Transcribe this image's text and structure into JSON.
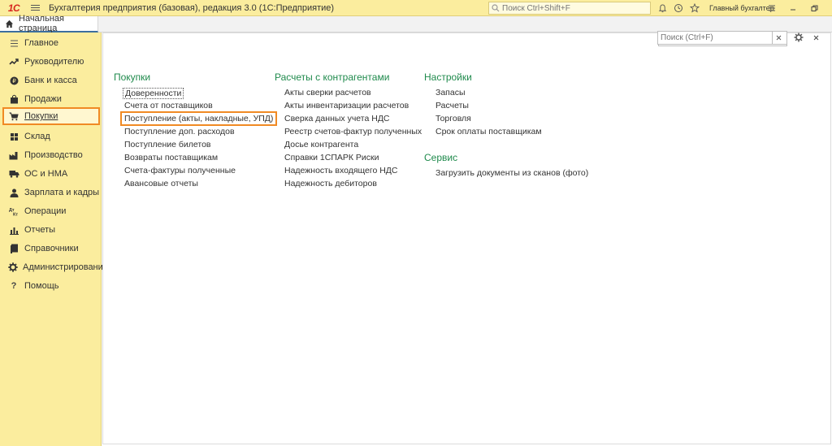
{
  "app": {
    "logo": "1С",
    "title": "Бухгалтерия предприятия (базовая), редакция 3.0  (1С:Предприятие)",
    "search_placeholder": "Поиск Ctrl+Shift+F",
    "user": "Главный бухгалтер"
  },
  "tabs": {
    "home": "Начальная страница"
  },
  "sidebar": {
    "items": [
      {
        "label": "Главное",
        "icon": "menu-icon"
      },
      {
        "label": "Руководителю",
        "icon": "trend-icon"
      },
      {
        "label": "Банк и касса",
        "icon": "coin-icon"
      },
      {
        "label": "Продажи",
        "icon": "bag-icon"
      },
      {
        "label": "Покупки",
        "icon": "cart-icon",
        "active": true
      },
      {
        "label": "Склад",
        "icon": "warehouse-icon"
      },
      {
        "label": "Производство",
        "icon": "factory-icon"
      },
      {
        "label": "ОС и НМА",
        "icon": "truck-icon"
      },
      {
        "label": "Зарплата и кадры",
        "icon": "person-icon"
      },
      {
        "label": "Операции",
        "icon": "operations-icon"
      },
      {
        "label": "Отчеты",
        "icon": "bar-chart-icon"
      },
      {
        "label": "Справочники",
        "icon": "book-icon"
      },
      {
        "label": "Администрирование",
        "icon": "gear-icon"
      },
      {
        "label": "Помощь",
        "icon": "help-icon"
      }
    ]
  },
  "main": {
    "search_placeholder": "Поиск (Ctrl+F)",
    "columns": [
      {
        "title": "Покупки",
        "links": [
          "Доверенности",
          "Счета от поставщиков",
          "Поступление (акты, накладные, УПД)",
          "Поступление доп. расходов",
          "Поступление билетов",
          "Возвраты поставщикам",
          "Счета-фактуры полученные",
          "Авансовые отчеты"
        ]
      },
      {
        "title": "Расчеты с контрагентами",
        "links": [
          "Акты сверки расчетов",
          "Акты инвентаризации расчетов",
          "Сверка данных учета НДС",
          "Реестр счетов-фактур полученных",
          "Досье контрагента",
          "Справки 1СПАРК Риски",
          "Надежность входящего НДС",
          "Надежность дебиторов"
        ]
      },
      {
        "title": "Настройки",
        "links": [
          "Запасы",
          "Расчеты",
          "Торговля",
          "Срок оплаты поставщикам"
        ]
      },
      {
        "title": "Сервис",
        "links": [
          "Загрузить документы из сканов (фото)"
        ]
      }
    ]
  },
  "colors": {
    "accent_yellow": "#fbed9e",
    "section_green": "#1f8a4c",
    "highlight_orange": "#f08a24"
  }
}
